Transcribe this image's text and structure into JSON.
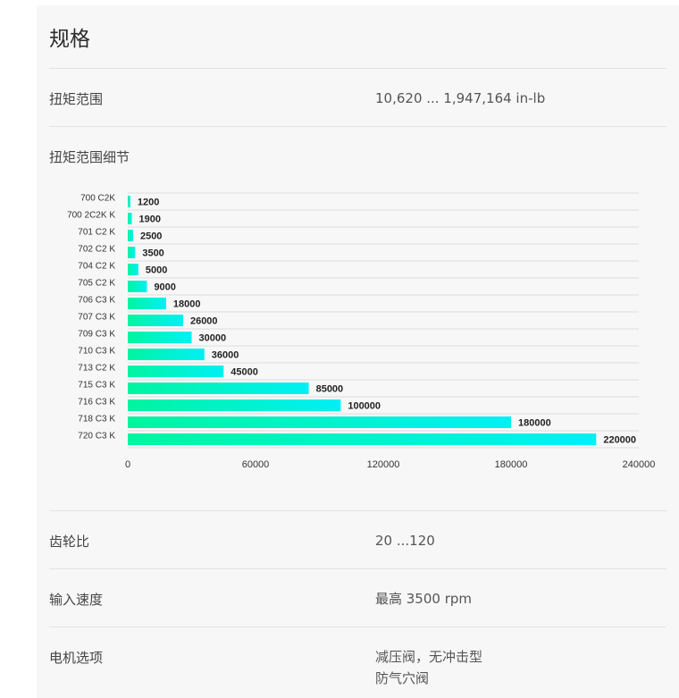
{
  "section_title": "规格",
  "specs": {
    "torque_range": {
      "label": "扭矩范围",
      "value": "10,620 ... 1,947,164 in-lb"
    },
    "torque_detail": {
      "label": "扭矩范围细节"
    },
    "gear_ratio": {
      "label": "齿轮比",
      "value": "20 ...120"
    },
    "input_speed": {
      "label": "输入速度",
      "value": "最高 3500 rpm"
    },
    "motor_options": {
      "label": "电机选项",
      "value_line1": "减压阀，无冲击型",
      "value_line2": "防气穴阀"
    }
  },
  "chart_data": {
    "type": "bar",
    "orientation": "horizontal",
    "categories": [
      "700 C2K",
      "700 2C2K K",
      "701 C2 K",
      "702 C2 K",
      "704 C2 K",
      "705 C2 K",
      "706 C3 K",
      "707 C3 K",
      "709 C3 K",
      "710 C3 K",
      "713 C2 K",
      "715 C3 K",
      "716 C3 K",
      "718 C3 K",
      "720 C3 K"
    ],
    "values": [
      1200,
      1900,
      2500,
      3500,
      5000,
      9000,
      18000,
      26000,
      30000,
      36000,
      45000,
      85000,
      100000,
      180000,
      220000
    ],
    "value_labels": [
      "1200",
      "1900",
      "2500",
      "3500",
      "5000",
      "9000",
      "18000",
      "26000",
      "30000",
      "36000",
      "45000",
      "85000",
      "100000",
      "180000",
      "220000"
    ],
    "xlim": [
      0,
      240000
    ],
    "xticks": [
      "0",
      "60000",
      "120000",
      "180000",
      "240000"
    ],
    "grid": true,
    "colors": {
      "gradient_start": "#00f5a0",
      "gradient_end": "#00f0f5",
      "gridline": "#dddddd"
    }
  }
}
